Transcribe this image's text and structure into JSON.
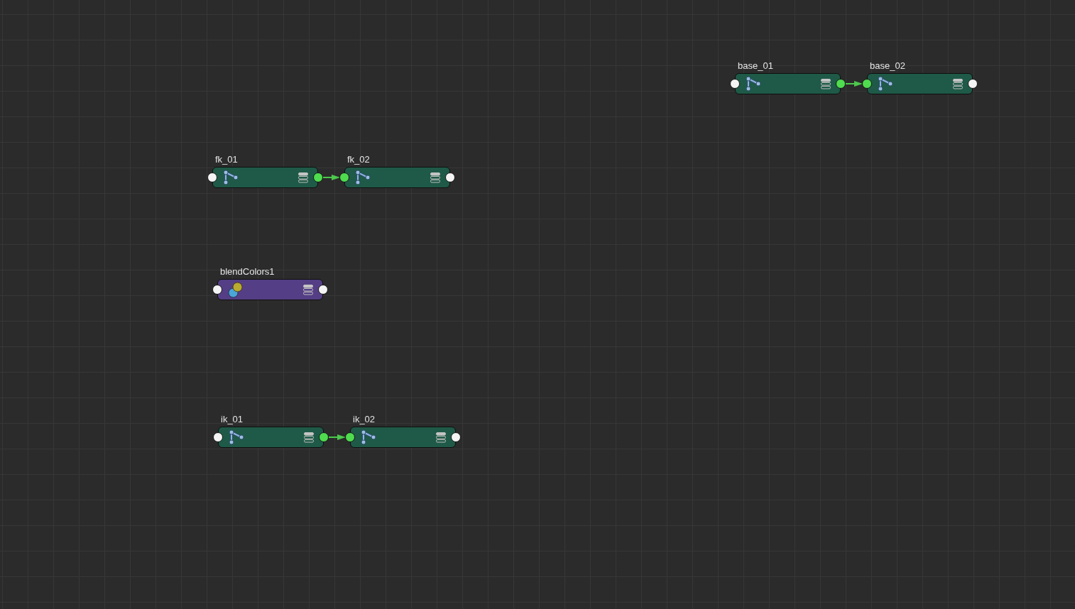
{
  "node_editor": {
    "chains": [
      {
        "nodes": [
          {
            "name": "base_01",
            "kind": "joint",
            "input_connected": false,
            "output_connected": true
          },
          {
            "name": "base_02",
            "kind": "joint",
            "input_connected": true,
            "output_connected": false
          }
        ]
      },
      {
        "nodes": [
          {
            "name": "fk_01",
            "kind": "joint",
            "input_connected": false,
            "output_connected": true
          },
          {
            "name": "fk_02",
            "kind": "joint",
            "input_connected": true,
            "output_connected": false
          }
        ]
      },
      {
        "nodes": [
          {
            "name": "blendColors1",
            "kind": "blend",
            "input_connected": false,
            "output_connected": false
          }
        ]
      },
      {
        "nodes": [
          {
            "name": "ik_01",
            "kind": "joint",
            "input_connected": false,
            "output_connected": true
          },
          {
            "name": "ik_02",
            "kind": "joint",
            "input_connected": true,
            "output_connected": false
          }
        ]
      }
    ]
  }
}
